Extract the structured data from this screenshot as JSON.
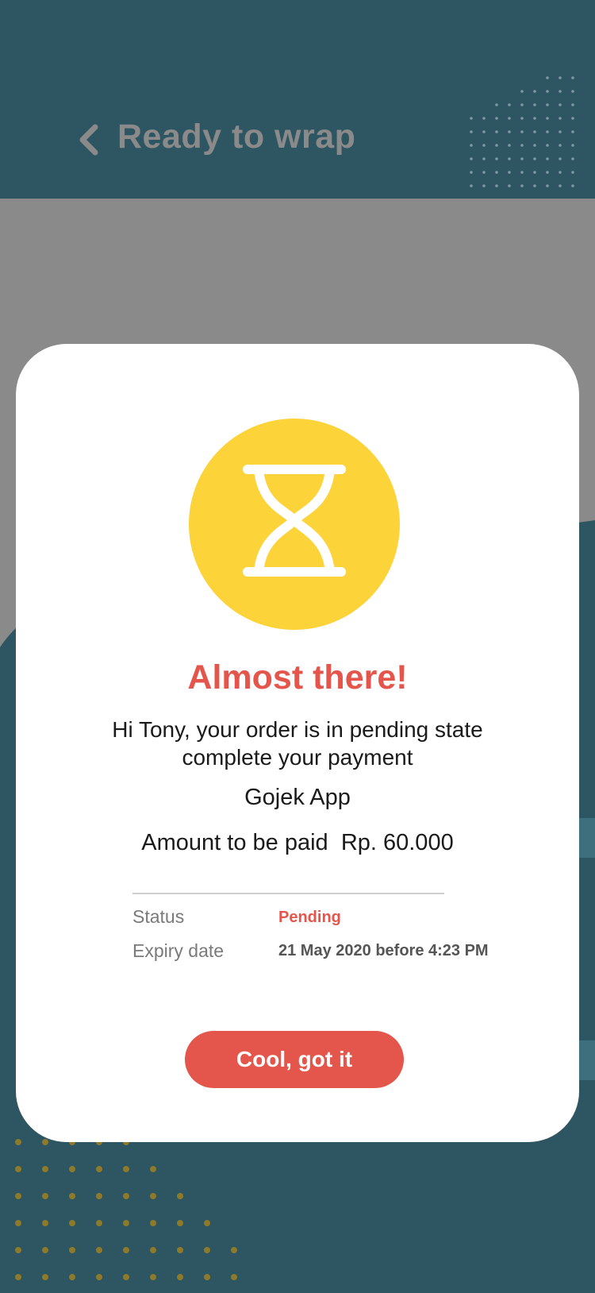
{
  "header": {
    "title": "Ready to wrap",
    "back_icon": "chevron-left-icon"
  },
  "dialog": {
    "icon": "hourglass-icon",
    "icon_color": "#fdd33a",
    "title": "Almost there!",
    "message_line1": "Hi Tony, your order is in pending state",
    "message_line2": "complete your payment",
    "app_name": "Gojek App",
    "amount_label": "Amount to be paid",
    "amount_value": "Rp. 60.000",
    "status_label": "Status",
    "status_value": "Pending",
    "expiry_label": "Expiry date",
    "expiry_value": "21 May 2020 before 4:23 PM",
    "button_label": "Cool, got it"
  },
  "colors": {
    "header_bg": "#2e5562",
    "accent": "#e4564b",
    "overlay": "#8a8a8a",
    "dots": "#8d7a2a"
  }
}
